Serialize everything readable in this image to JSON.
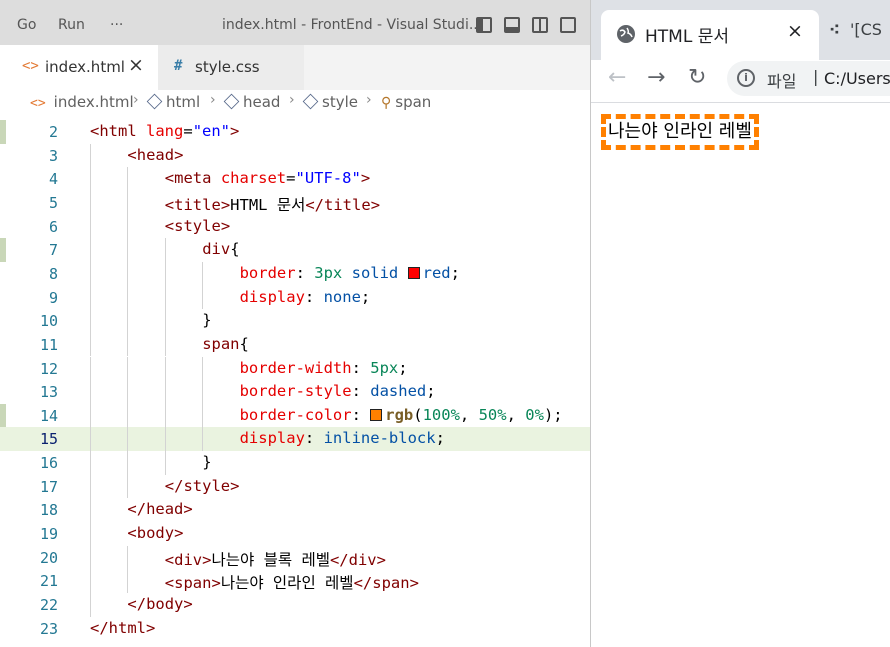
{
  "vscode": {
    "menu": [
      "Go",
      "Run",
      "···"
    ],
    "window_title": "index.html - FrontEnd - Visual Studi...",
    "tabs": [
      {
        "icon": "<>",
        "label": "index.html",
        "close": "×"
      },
      {
        "icon": "#",
        "label": "style.css"
      }
    ],
    "breadcrumb": [
      {
        "icon": "<>",
        "label": "index.html"
      },
      {
        "icon": "cube",
        "label": "html"
      },
      {
        "icon": "cube",
        "label": "head"
      },
      {
        "icon": "cube",
        "label": "style"
      },
      {
        "icon": "tree",
        "label": "span"
      }
    ],
    "active_line": 15,
    "lines": [
      {
        "n": "2",
        "indent": 0,
        "tokens": [
          [
            "punc",
            "<"
          ],
          [
            "tag",
            "html"
          ],
          [
            "text",
            " "
          ],
          [
            "attr",
            "lang"
          ],
          [
            "text",
            "="
          ],
          [
            "str",
            "\"en\""
          ],
          [
            "punc",
            ">"
          ]
        ]
      },
      {
        "n": "3",
        "indent": 1,
        "tokens": [
          [
            "punc",
            "<"
          ],
          [
            "tag",
            "head"
          ],
          [
            "punc",
            ">"
          ]
        ]
      },
      {
        "n": "4",
        "indent": 2,
        "tokens": [
          [
            "punc",
            "<"
          ],
          [
            "tag",
            "meta"
          ],
          [
            "text",
            " "
          ],
          [
            "attr",
            "charset"
          ],
          [
            "text",
            "="
          ],
          [
            "str",
            "\"UTF-8\""
          ],
          [
            "punc",
            ">"
          ]
        ]
      },
      {
        "n": "5",
        "indent": 2,
        "tokens": [
          [
            "punc",
            "<"
          ],
          [
            "tag",
            "title"
          ],
          [
            "punc",
            ">"
          ],
          [
            "text",
            "HTML 문서"
          ],
          [
            "punc",
            "</"
          ],
          [
            "tag",
            "title"
          ],
          [
            "punc",
            ">"
          ]
        ]
      },
      {
        "n": "6",
        "indent": 2,
        "tokens": [
          [
            "punc",
            "<"
          ],
          [
            "tag",
            "style"
          ],
          [
            "punc",
            ">"
          ]
        ]
      },
      {
        "n": "7",
        "indent": 3,
        "tokens": [
          [
            "sel",
            "div"
          ],
          [
            "text",
            "{"
          ]
        ]
      },
      {
        "n": "8",
        "indent": 4,
        "tokens": [
          [
            "prop",
            "border"
          ],
          [
            "text",
            ": "
          ],
          [
            "num",
            "3px"
          ],
          [
            "text",
            " "
          ],
          [
            "val",
            "solid"
          ],
          [
            "text",
            " "
          ],
          [
            "swatch",
            "#ff0000"
          ],
          [
            "val",
            "red"
          ],
          [
            "text",
            ";"
          ]
        ]
      },
      {
        "n": "9",
        "indent": 4,
        "tokens": [
          [
            "prop",
            "display"
          ],
          [
            "text",
            ": "
          ],
          [
            "val",
            "none"
          ],
          [
            "text",
            ";"
          ]
        ]
      },
      {
        "n": "10",
        "indent": 3,
        "tokens": [
          [
            "text",
            "}"
          ]
        ]
      },
      {
        "n": "11",
        "indent": 3,
        "tokens": [
          [
            "sel",
            "span"
          ],
          [
            "text",
            "{"
          ]
        ]
      },
      {
        "n": "12",
        "indent": 4,
        "tokens": [
          [
            "prop",
            "border-width"
          ],
          [
            "text",
            ": "
          ],
          [
            "num",
            "5px"
          ],
          [
            "text",
            ";"
          ]
        ]
      },
      {
        "n": "13",
        "indent": 4,
        "tokens": [
          [
            "prop",
            "border-style"
          ],
          [
            "text",
            ": "
          ],
          [
            "val",
            "dashed"
          ],
          [
            "text",
            ";"
          ]
        ]
      },
      {
        "n": "14",
        "indent": 4,
        "tokens": [
          [
            "prop",
            "border-color"
          ],
          [
            "text",
            ": "
          ],
          [
            "swatch",
            "#ff8000"
          ],
          [
            "fn",
            "rgb"
          ],
          [
            "text",
            "("
          ],
          [
            "num",
            "100%"
          ],
          [
            "text",
            ", "
          ],
          [
            "num",
            "50%"
          ],
          [
            "text",
            ", "
          ],
          [
            "num",
            "0%"
          ],
          [
            "text",
            ");"
          ]
        ]
      },
      {
        "n": "15",
        "indent": 4,
        "tokens": [
          [
            "prop",
            "display"
          ],
          [
            "text",
            ": "
          ],
          [
            "val",
            "inline-block"
          ],
          [
            "text",
            ";"
          ]
        ]
      },
      {
        "n": "16",
        "indent": 3,
        "tokens": [
          [
            "text",
            "}"
          ]
        ]
      },
      {
        "n": "17",
        "indent": 2,
        "tokens": [
          [
            "punc",
            "</"
          ],
          [
            "tag",
            "style"
          ],
          [
            "punc",
            ">"
          ]
        ]
      },
      {
        "n": "18",
        "indent": 1,
        "tokens": [
          [
            "punc",
            "</"
          ],
          [
            "tag",
            "head"
          ],
          [
            "punc",
            ">"
          ]
        ]
      },
      {
        "n": "19",
        "indent": 1,
        "tokens": [
          [
            "punc",
            "<"
          ],
          [
            "tag",
            "body"
          ],
          [
            "punc",
            ">"
          ]
        ]
      },
      {
        "n": "20",
        "indent": 2,
        "tokens": [
          [
            "punc",
            "<"
          ],
          [
            "tag",
            "div"
          ],
          [
            "punc",
            ">"
          ],
          [
            "text",
            "나는야 블록 레벨"
          ],
          [
            "punc",
            "</"
          ],
          [
            "tag",
            "div"
          ],
          [
            "punc",
            ">"
          ]
        ]
      },
      {
        "n": "21",
        "indent": 2,
        "tokens": [
          [
            "punc",
            "<"
          ],
          [
            "tag",
            "span"
          ],
          [
            "punc",
            ">"
          ],
          [
            "text",
            "나는야 인라인 레벨"
          ],
          [
            "punc",
            "</"
          ],
          [
            "tag",
            "span"
          ],
          [
            "punc",
            ">"
          ]
        ]
      },
      {
        "n": "22",
        "indent": 1,
        "tokens": [
          [
            "punc",
            "</"
          ],
          [
            "tag",
            "body"
          ],
          [
            "punc",
            ">"
          ]
        ]
      },
      {
        "n": "23",
        "indent": 0,
        "tokens": [
          [
            "punc",
            "</"
          ],
          [
            "tag",
            "html"
          ],
          [
            "punc",
            ">"
          ]
        ]
      }
    ]
  },
  "browser": {
    "tab_title": "HTML 문서",
    "tab_close": "×",
    "second_tab": "'[CS",
    "back": "←",
    "forward": "→",
    "reload": "↻",
    "info": "i",
    "url_label": "파일",
    "url_sep": "|",
    "url": "C:/Users/",
    "content_text": "나는야 인라인 레벨",
    "border_color": "#ff8000"
  }
}
